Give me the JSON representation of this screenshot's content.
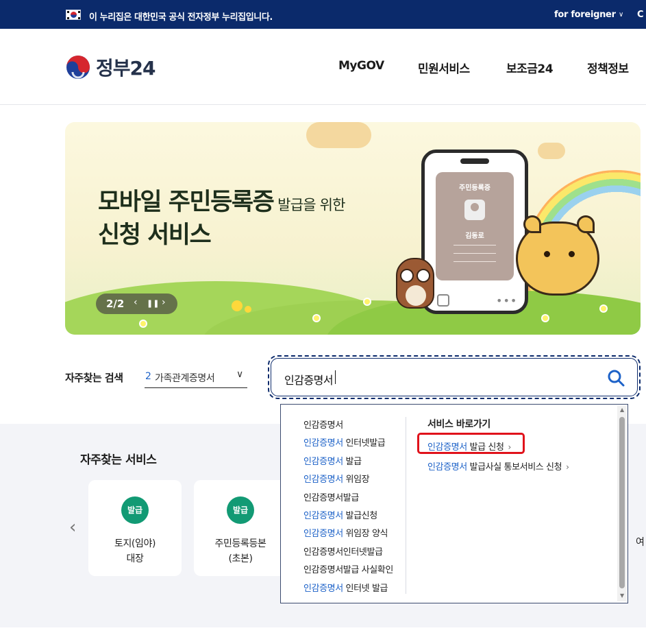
{
  "govbar": {
    "notice": "이 누리집은 대한민국 공식 전자정부 누리집입니다.",
    "foreigner": "for foreigner",
    "cut_text": "C"
  },
  "header": {
    "logo_text": "정부24",
    "nav": [
      "MyGOV",
      "민원서비스",
      "보조금24",
      "정책정보"
    ]
  },
  "banner": {
    "title_main": "모바일 주민등록증",
    "title_small": " 발급을 위한",
    "title_line2": "신청 서비스",
    "pager": "2/2",
    "card_title": "주민등록증",
    "card_name": "김동로"
  },
  "frequent_search": {
    "label": "자주찾는 검색",
    "select_num": "2",
    "select_text": "가족관계증명서"
  },
  "search": {
    "value": "인감증명서"
  },
  "autocomplete": {
    "items": [
      {
        "hl": "",
        "rest": "인감증명서"
      },
      {
        "hl": "인감증명서",
        "rest": " 인터넷발급"
      },
      {
        "hl": "인감증명서",
        "rest": " 발급"
      },
      {
        "hl": "인감증명서",
        "rest": " 위임장"
      },
      {
        "hl": "",
        "rest": "인감증명서발급"
      },
      {
        "hl": "인감증명서",
        "rest": " 발급신청"
      },
      {
        "hl": "인감증명서",
        "rest": " 위임장 양식"
      },
      {
        "hl": "",
        "rest": "인감증명서인터넷발급"
      },
      {
        "hl": "",
        "rest": "인감증명서발급 사실확인"
      },
      {
        "hl": "인감증명서",
        "rest": " 인터넷 발급"
      }
    ],
    "quick_title": "서비스 바로가기",
    "quick_links": [
      {
        "hl": "인감증명서",
        "rest": " 발급 신청"
      },
      {
        "hl": "인감증명서",
        "rest": " 발급사실 통보서비스 신청"
      }
    ]
  },
  "services": {
    "title": "자주찾는 서비스",
    "cards": [
      {
        "badge": "발급",
        "line1": "토지(임야)",
        "line2": "대장"
      },
      {
        "badge": "발급",
        "line1": "주민등록등본",
        "line2": "(초본)"
      }
    ],
    "edge_text": "여"
  },
  "colors": {
    "gov_navy": "#0b2a6b",
    "link_blue": "#1d62c8",
    "badge_green": "#129a74",
    "highlight_red": "#e0121b"
  }
}
